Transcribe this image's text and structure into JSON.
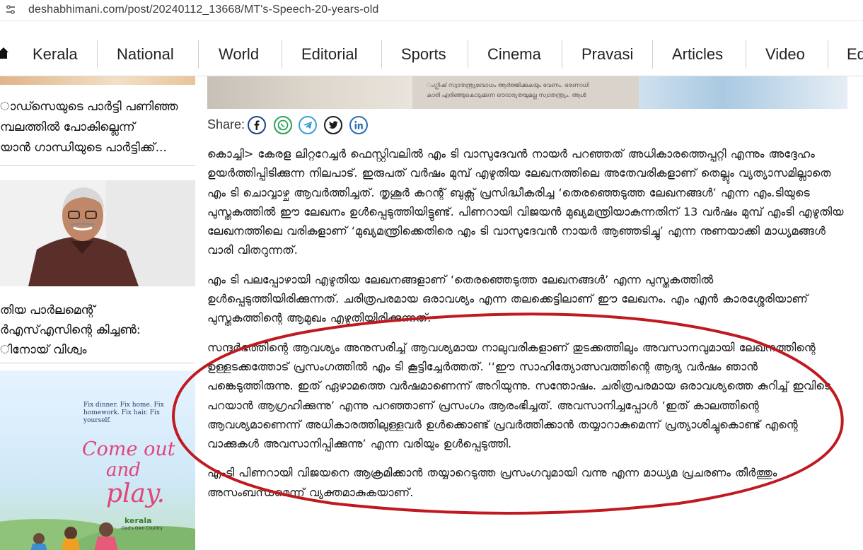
{
  "browser": {
    "url": "deshabhimani.com/post/20240112_13668/MT's-Speech-20-years-old"
  },
  "nav": {
    "items": [
      "Kerala",
      "National",
      "World",
      "Editorial",
      "Sports",
      "Cinema",
      "Pravasi",
      "Articles",
      "Video",
      "Ed"
    ]
  },
  "sidebar": {
    "story1": [
      "ാഡ്സെയുടെ പാർട്ടി പണിഞ്ഞ",
      "മ്പലത്തിൽ പോകില്ലെന്ന്",
      "യാൻ ഗാന്ധിയുടെ പാർട്ടിക്ക്..."
    ],
    "story2": [
      "തിയ പാർലമെന്റ്",
      "ർഎസ്എസിന്റെ കിച്ചൺ:",
      "ിനോയ് വിശ്വം"
    ],
    "ad": {
      "tagline": "Fix dinner. Fix home. Fix homework. Fix hair. Fix yourself.",
      "headline_1": "Come out",
      "headline_2": "and",
      "headline_3": "play.",
      "brand": "kerala",
      "brand_sub": "God's Own Country"
    }
  },
  "article": {
    "hero_caption_1": "ംഗ്ലിഷ് സ്വാതന്ത്ര്യബോധം ആർജ്ജിക്കുകയും വേണം. ഭരണാധി",
    "hero_caption_2": "കാരി ഏരിഞ്ഞുകൊടുക്കുന്ന ഔദാര്യതയുമല്ല സ്വാതന്ത്ര്യം. ആൾ",
    "share_label": "Share:",
    "paragraphs": [
      "കൊച്ചി> കേരള  ലിറ്ററേച്ചർ ഫെസ്റ്റിവലിൽ എം ടി വാസുദേവൻ നായർ പറഞ്ഞത് അധികാരത്തെപ്പറ്റി എന്നും അദ്ദേഹം ഉയർത്തിപ്പിടിക്കുന്ന നിലപാട്. ഇരുപത് വർഷം മുമ്പ് എഴുതിയ ലേഖനത്തിലെ അതേവരികളാണ് തെല്ലും വ്യത്യാസമില്ലാതെ എം ടി  ചൊവ്വാഴ്ച ആവർത്തിച്ചത്. തൃശൂർ കറന്റ് ബുക്സ് പ്രസിദ്ധീകരിച്ച ‘തെരഞ്ഞെടുത്ത ലേഖനങ്ങൾ’ എന്ന എം.ടിയുടെ പുസ്തകത്തിൽ ഈ ലേഖനം ഉൾപ്പെടുത്തിയിട്ടുണ്ട്. പിണറായി വിജയൻ മുഖ്യമന്ത്രിയാകുന്നതിന് 13 വർഷം മുമ്പ് എംടി എഴുതിയ ലേഖനത്തിലെ വരികളാണ് ‘മുഖ്യമന്ത്രിക്കെതിരെ എം ടി വാസുദേവൻ നായർ ആഞ്ഞടിച്ചു’ എന്ന നുണയാക്കി മാധ്യമങ്ങൾ വാരി വിതറുന്നത്.",
      " എം ടി പലപ്പോഴായി എഴുതിയ ലേഖനങ്ങളാണ് ‘തെരഞ്ഞെടുത്ത ലേഖനങ്ങൾ’ എന്ന പുസ്തകത്തിൽ ഉൾപ്പെടുത്തിയിരിക്കുന്നത്. ചരിത്രപരമായ ഒരാവശ്യം എന്ന തലക്കെട്ടിലാണ് ഈ ലേഖനം. എം എൻ കാരശ്ശേരിയാണ് പുസ്തകത്തിന്റെ ആമുഖം എഴുതിയിരിക്കുന്നത്.",
      "സന്ദർഭത്തിന്റെ ആവശ്യം അനുസരിച്ച് ആവശ്യമായ നാലുവരികളാണ് തുടക്കത്തിലും അവസാനവുമായി ലേഖനത്തിന്റെ ഉള്ളടക്കത്തോട് പ്രസംഗത്തിൽ എം ടി കൂട്ടിച്ചേർത്തത്. ‘‘ഈ സാഹിത്യോത്സവത്തിന്റെ ആദ്യ വർഷം ഞാൻ പങ്കെടുത്തിരുന്നു. ഇത് ഏഴാമത്തെ വർഷമാണെന്ന് അറിയുന്നു. സന്തോഷം. ചരിത്രപരമായ ഒരാവശ്യത്തെ കുറിച്ച് ഇവിടെ പറയാൻ ആഗ്രഹിക്കുന്നു’ എന്നു പറഞ്ഞാണ് പ്രസംഗം ആരംഭിച്ചത്. അവസാനിച്ചപ്പോൾ ‘ഇത് കാലത്തിന്റെ ആവശ്യമാണെന്ന് അധികാരത്തിലുള്ളവർ ഉൾക്കൊണ്ട് പ്രവർത്തിക്കാൻ തയ്യാറാകുമെന്ന് പ്രത്യാശിച്ചുകൊണ്ട് എന്റെ വാക്കുകൾ അവസാനിപ്പിക്കുന്നു’ എന്ന വരിയും ഉൾപ്പെടുത്തി.",
      "എംടി പിണറായി വിജയനെ ആക്രമിക്കാൻ തയ്യാറെടുത്ത പ്രസംഗവുമായി വന്നു എന്ന മാധ്യമ പ്രചരണം തീർത്തും അസംബന്ധമെന്ന് വ്യക്തമാകുകയാണ്."
    ]
  },
  "colors": {
    "annotation_circle": "#c0191f",
    "facebook": "#1f3f8a",
    "whatsapp": "#2e9e58",
    "telegram": "#3a9fd6",
    "twitter": "#1a1a1a",
    "linkedin": "#2b6cb0"
  },
  "icons": [
    "site-info-icon",
    "home-icon",
    "facebook-icon",
    "whatsapp-icon",
    "telegram-icon",
    "twitter-icon",
    "linkedin-icon"
  ]
}
